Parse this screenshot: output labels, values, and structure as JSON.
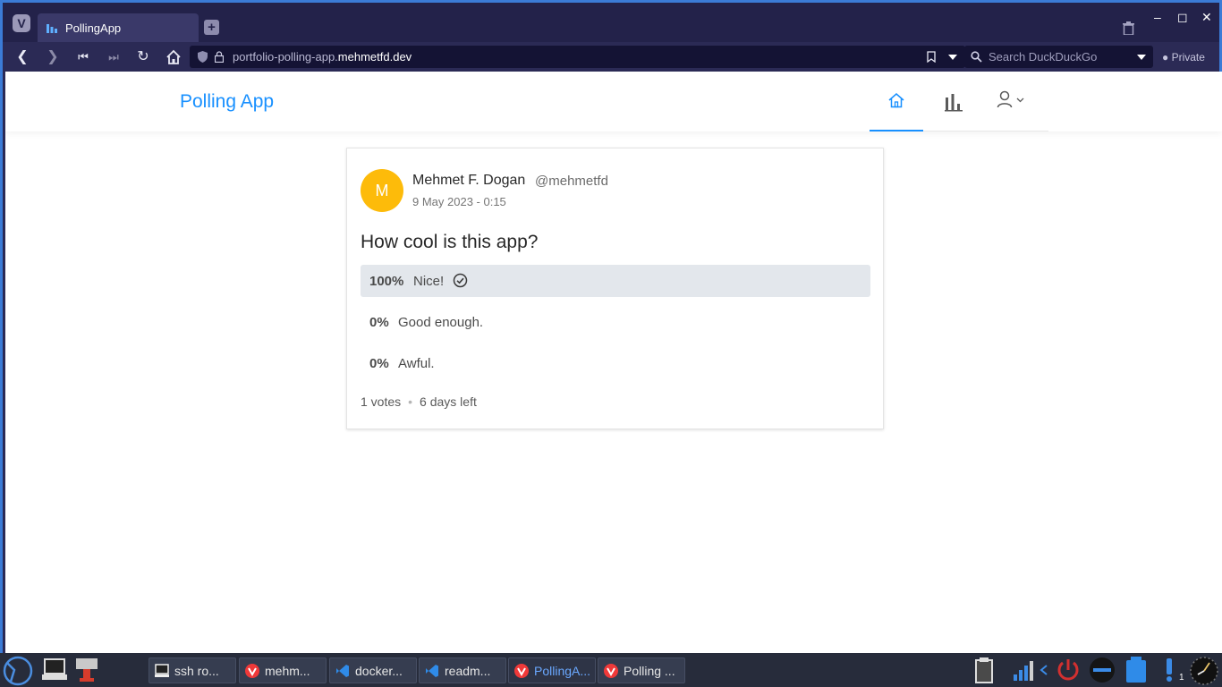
{
  "browser": {
    "tab_title": "PollingApp",
    "url_prefix": "portfolio-polling-app.",
    "url_domain": "mehmetfd.dev",
    "search_placeholder": "Search DuckDuckGo",
    "private_label": "Private"
  },
  "app": {
    "title": "Polling App",
    "nav": [
      "home-icon",
      "bar-chart-icon",
      "user-icon"
    ]
  },
  "poll": {
    "avatar_letter": "M",
    "author_name": "Mehmet F. Dogan",
    "author_handle": "@mehmetfd",
    "date": "9 May 2023 - 0:15",
    "question": "How cool is this app?",
    "choices": [
      {
        "percent_label": "100%",
        "percent_value": 100,
        "text": "Nice!",
        "selected": true
      },
      {
        "percent_label": "0%",
        "percent_value": 0,
        "text": "Good enough.",
        "selected": false
      },
      {
        "percent_label": "0%",
        "percent_value": 0,
        "text": "Awful.",
        "selected": false
      }
    ],
    "votes": "1 votes",
    "time_left": "6 days left"
  },
  "taskbar": {
    "items": [
      {
        "label": "ssh ro...",
        "icon": "terminal-icon"
      },
      {
        "label": "mehm...",
        "icon": "vivaldi-icon"
      },
      {
        "label": "docker...",
        "icon": "vscode-icon"
      },
      {
        "label": "readm...",
        "icon": "vscode-icon"
      },
      {
        "label": "PollingA...",
        "icon": "vivaldi-icon"
      },
      {
        "label": "Polling ...",
        "icon": "vivaldi-icon"
      }
    ],
    "tray_badge": "1"
  },
  "colors": {
    "accent": "#1890ff",
    "avatar": "#fdbb0a",
    "selected_fill": "#e3e7ec"
  }
}
